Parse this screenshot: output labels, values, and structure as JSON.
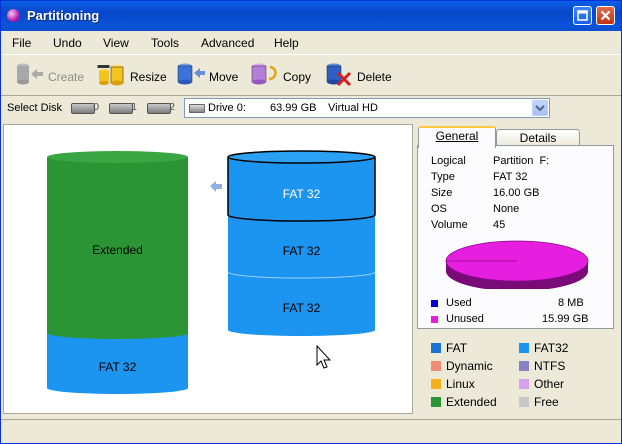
{
  "window": {
    "title": "Partitioning"
  },
  "menu": [
    "File",
    "Undo",
    "View",
    "Tools",
    "Advanced",
    "Help"
  ],
  "toolbar": {
    "create": "Create",
    "resize": "Resize",
    "move": "Move",
    "copy": "Copy",
    "delete": "Delete"
  },
  "diskbar": {
    "label": "Select Disk",
    "disks": [
      "0",
      "1",
      "2"
    ],
    "drive": {
      "name": "Drive 0:",
      "size": "63.99 GB",
      "type": "Virtual HD"
    }
  },
  "disk0": {
    "partitions": [
      {
        "label": "Extended",
        "color": "#2b9434"
      },
      {
        "label": "FAT 32",
        "color": "#1b95ef"
      }
    ]
  },
  "disk1": {
    "partitions": [
      {
        "label": "FAT 32",
        "color": "#1b95ef",
        "selected": true
      },
      {
        "label": "FAT 32",
        "color": "#1b95ef"
      },
      {
        "label": "FAT 32",
        "color": "#1b95ef"
      }
    ]
  },
  "tabs": {
    "general": "General",
    "details": "Details"
  },
  "props": {
    "logical_key": "Logical",
    "logical_val": "Partition  F:",
    "type_key": "Type",
    "type_val": "FAT 32",
    "size_key": "Size",
    "size_val": "16.00 GB",
    "os_key": "OS",
    "os_val": "None",
    "volume_key": "Volume",
    "volume_val": "45"
  },
  "usage": {
    "used_label": "Used",
    "used_val": "8 MB",
    "used_color": "#0000cc",
    "unused_label": "Unused",
    "unused_val": "15.99 GB",
    "unused_color": "#e61ee0",
    "used_fraction": 0.0005
  },
  "legend": [
    {
      "label": "FAT",
      "color": "#1b73d6"
    },
    {
      "label": "FAT32",
      "color": "#1b95ef"
    },
    {
      "label": "Dynamic",
      "color": "#f08c74"
    },
    {
      "label": "NTFS",
      "color": "#8a82c8"
    },
    {
      "label": "Linux",
      "color": "#f6b21b"
    },
    {
      "label": "Other",
      "color": "#d6a0ea"
    },
    {
      "label": "Extended",
      "color": "#2b9434"
    },
    {
      "label": "Free",
      "color": "#c8c8c8"
    }
  ]
}
